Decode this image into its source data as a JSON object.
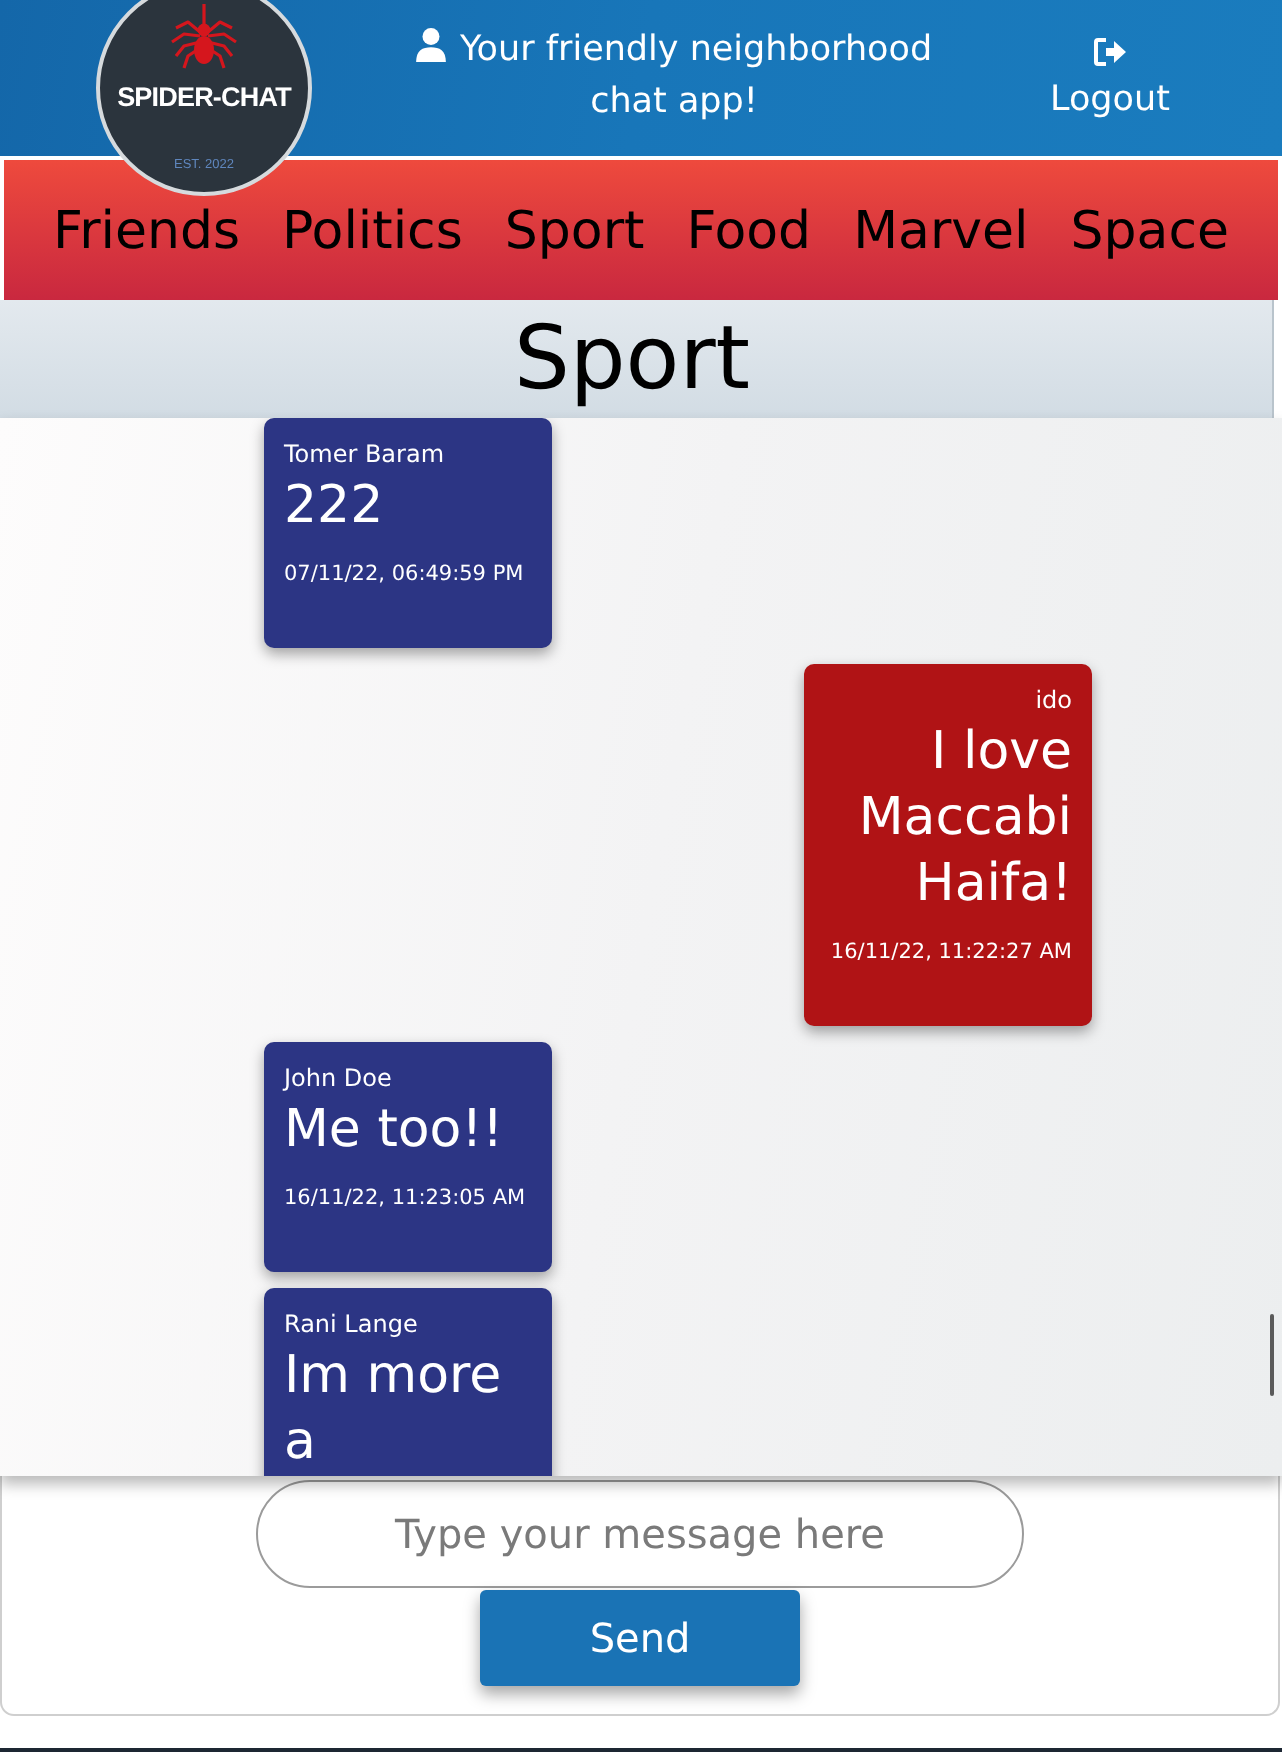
{
  "header": {
    "logo": {
      "title": "SPIDER-CHAT",
      "established": "EST. 2022"
    },
    "tagline": "Your friendly neighborhood chat app!",
    "logout": "Logout"
  },
  "nav": [
    "Friends",
    "Politics",
    "Sport",
    "Food",
    "Marvel",
    "Space"
  ],
  "room": {
    "title": "Sport"
  },
  "messages": [
    {
      "author": "Tomer Baram",
      "text": "222",
      "time": "07/11/22, 06:49:59 PM",
      "own": false
    },
    {
      "author": "ido",
      "text": "I love Maccabi Haifa!",
      "time": "16/11/22, 11:22:27 AM",
      "own": true
    },
    {
      "author": "John Doe",
      "text": "Me too!!",
      "time": "16/11/22, 11:23:05 AM",
      "own": false
    },
    {
      "author": "Rani Lange",
      "text": "Im more a",
      "own": false
    }
  ],
  "composer": {
    "placeholder": "Type your message here",
    "button": "Send"
  }
}
